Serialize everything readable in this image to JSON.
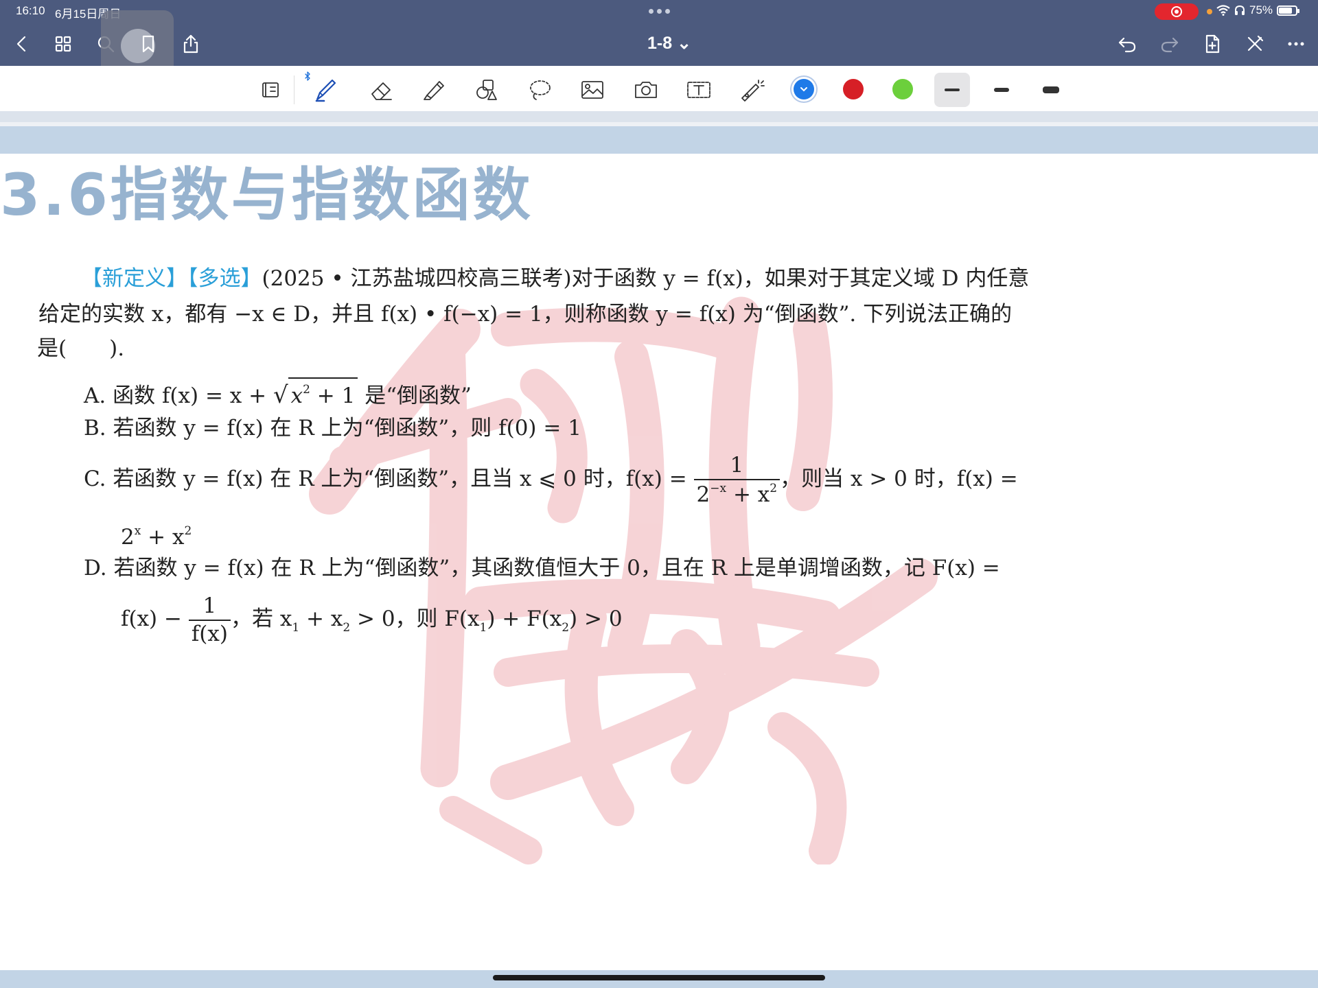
{
  "status_bar": {
    "time": "16:10",
    "date": "6月15日周日",
    "battery": "75%"
  },
  "nav": {
    "page_label": "1-8 ⌄"
  },
  "colors": {
    "topbar": "#4c5a7e",
    "blue_swatch": "#1f7ae8",
    "red_swatch": "#d61f26",
    "green_swatch": "#6ccf3c",
    "tag_blue": "#2a9fd8",
    "title_blue": "#97b3cf"
  },
  "toolbar": {
    "tools": [
      "page-icon",
      "pen-icon",
      "eraser-icon",
      "highlighter-icon",
      "shapes-icon",
      "lasso-icon",
      "image-icon",
      "camera-icon",
      "text-box-icon",
      "laser-pointer-icon"
    ],
    "selected_color": "blue",
    "selected_stroke": "thin"
  },
  "document": {
    "section_title": "3.6指数与指数函数",
    "question": {
      "tag1": "【新定义】",
      "tag2": "【多选】",
      "line1": "(2025 • 江苏盐城四校高三联考)对于函数 y = f(x)，如果对于其定义域 D 内任意",
      "line2": "给定的实数 x，都有 −x ∈ D，并且 f(x) • f(−x) = 1，则称函数 y = f(x) 为“倒函数”. 下列说法正确的",
      "line3": "是(　　)."
    },
    "options": {
      "a_prefix": "A.  函数 f(x) = x + ",
      "a_radicand": "x",
      "a_exp": "2",
      "a_plus1": " + 1",
      "a_suffix": " 是“倒函数”",
      "b": "B.  若函数 y = f(x) 在 R 上为“倒函数”，则 f(0) = 1",
      "c_prefix": "C.  若函数 y = f(x) 在 R 上为“倒函数”，且当 x ⩽ 0 时，f(x) = ",
      "c_num": "1",
      "c_den_base": "2",
      "c_den_exp": "−x",
      "c_den_rest": " + x",
      "c_den_exp2": "2",
      "c_suffix": "，则当 x > 0 时，f(x) =",
      "c_cont_base": "2",
      "c_cont_exp": "x",
      "c_cont_rest": " + x",
      "c_cont_exp2": "2",
      "d_line1": "D.  若函数 y = f(x) 在 R 上为“倒函数”，其函数值恒大于 0，且在 R 上是单调增函数，记 F(x) =",
      "d_pre": "f(x) − ",
      "d_num": "1",
      "d_den": "f(x)",
      "d_suffix_a": "，若 x",
      "d_sub1": "1",
      "d_suffix_b": " + x",
      "d_sub2": "2",
      "d_suffix_c": " > 0，则 F(x",
      "d_sub3": "1",
      "d_suffix_d": ") + F(x",
      "d_sub4": "2",
      "d_suffix_e": ") > 0"
    }
  }
}
